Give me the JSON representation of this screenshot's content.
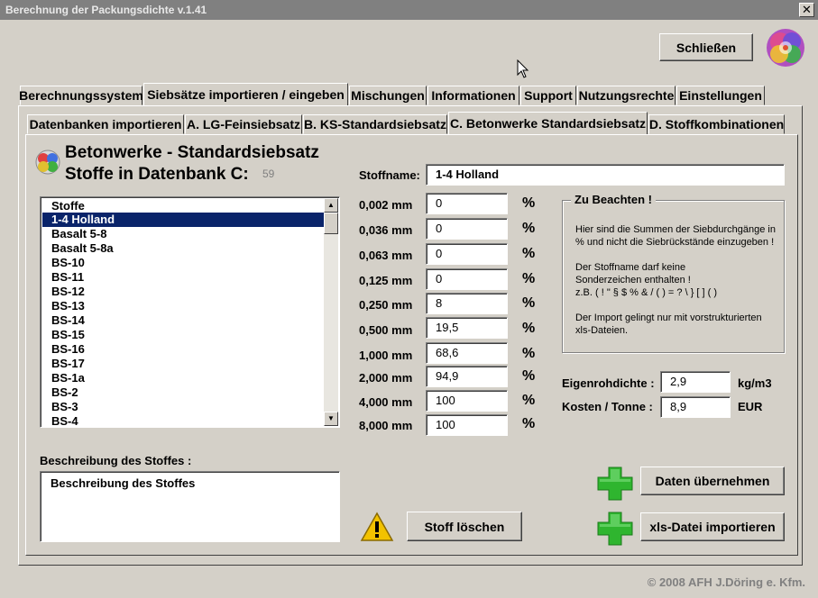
{
  "window": {
    "title": "Berechnung der Packungsdichte v.1.41",
    "close_glyph": "✕"
  },
  "header": {
    "close_button": "Schließen"
  },
  "main_tabs": [
    {
      "label": "Berechnungssystem",
      "active": false
    },
    {
      "label": "Siebsätze importieren / eingeben",
      "active": true
    },
    {
      "label": "Mischungen",
      "active": false
    },
    {
      "label": "Informationen",
      "active": false
    },
    {
      "label": "Support",
      "active": false
    },
    {
      "label": "Nutzungsrechte",
      "active": false
    },
    {
      "label": "Einstellungen",
      "active": false
    }
  ],
  "sub_tabs": [
    {
      "label": "Datenbanken importieren",
      "active": false
    },
    {
      "label": "A. LG-Feinsiebsatz",
      "active": false
    },
    {
      "label": "B. KS-Standardsiebsatz",
      "active": false
    },
    {
      "label": "C. Betonwerke Standardsiebsatz",
      "active": true
    },
    {
      "label": "D. Stoffkombinationen",
      "active": false
    }
  ],
  "panel": {
    "heading1": "Betonwerke - Standardsiebsatz",
    "heading2": "Stoffe in Datenbank C:",
    "count": "59",
    "list_header": "Stoffe",
    "list_items": [
      "1-4 Holland",
      "Basalt 5-8",
      "Basalt 5-8a",
      "BS-10",
      "BS-11",
      "BS-12",
      "BS-13",
      "BS-14",
      "BS-15",
      "BS-16",
      "BS-17",
      "BS-1a",
      "BS-2",
      "BS-3",
      "BS-4"
    ],
    "selected_index": 0,
    "stoffname_label": "Stoffname:",
    "stoffname_value": "1-4 Holland",
    "sieves": [
      {
        "size": "0,002 mm",
        "value": "0",
        "unit": "%"
      },
      {
        "size": "0,036 mm",
        "value": "0",
        "unit": "%"
      },
      {
        "size": "0,063 mm",
        "value": "0",
        "unit": "%"
      },
      {
        "size": "0,125 mm",
        "value": "0",
        "unit": "%"
      },
      {
        "size": "0,250 mm",
        "value": "8",
        "unit": "%"
      },
      {
        "size": "0,500 mm",
        "value": "19,5",
        "unit": "%"
      },
      {
        "size": "1,000 mm",
        "value": "68,6",
        "unit": "%"
      },
      {
        "size": "2,000 mm",
        "value": "94,9",
        "unit": "%"
      },
      {
        "size": "4,000 mm",
        "value": "100",
        "unit": "%"
      },
      {
        "size": "8,000 mm",
        "value": "100",
        "unit": "%"
      }
    ],
    "notice": {
      "title": "Zu Beachten !",
      "lines": [
        "Hier sind die Summen der Siebdurchgänge in",
        "% und nicht die Siebrückstände einzugeben !",
        "",
        "Der Stoffname darf keine",
        "Sonderzeichen enthalten !",
        "z.B. ( ! \" § $ % & / ( ) = ? \\ } [ ] ( )",
        "",
        "Der Import gelingt nur mit vorstrukturierten",
        "xls-Dateien."
      ]
    },
    "density": {
      "label": "Eigenrohdichte :",
      "value": "2,9",
      "unit": "kg/m3"
    },
    "cost": {
      "label": "Kosten / Tonne :",
      "value": "8,9",
      "unit": "EUR"
    },
    "description_label": "Beschreibung des Stoffes :",
    "description_value": "Beschreibung des Stoffes",
    "delete_button": "Stoff löschen",
    "apply_button": "Daten übernehmen",
    "import_button": "xls-Datei importieren"
  },
  "footer": {
    "copyright": "© 2008  AFH J.Döring e. Kfm."
  },
  "colors": {
    "face": "#d4d0c8",
    "selection": "#0a246a",
    "plus": "#2fb52f",
    "warning": "#f2c200"
  }
}
